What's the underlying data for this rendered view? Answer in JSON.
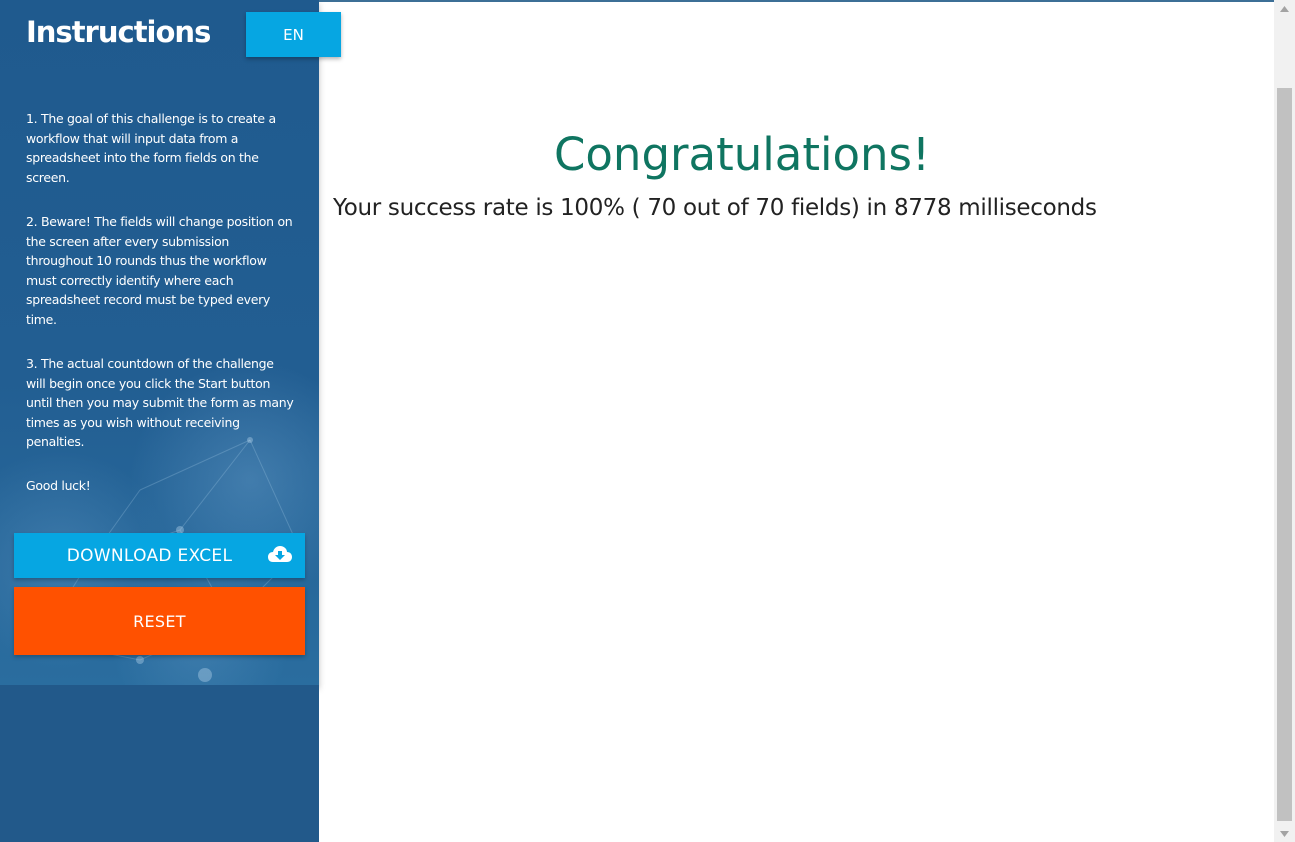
{
  "sidebar": {
    "title": "Instructions",
    "language_button": "EN",
    "instructions": [
      "1. The goal of this challenge is to create a workflow that will input data from a spreadsheet into the form fields on the screen.",
      "2. Beware! The fields will change position on the screen after every submission throughout 10 rounds thus the workflow must correctly identify where each spreadsheet record must be typed every time.",
      "3. The actual countdown of the challenge will begin once you click the Start button until then you may submit the form as many times as you wish without receiving penalties.",
      "Good luck!"
    ],
    "download_button": "DOWNLOAD EXCEL",
    "download_icon": "cloud-download-icon",
    "reset_button": "RESET"
  },
  "main": {
    "heading": "Congratulations!",
    "result": "Your success rate is 100% ( 70 out of 70 fields) in 8778 milliseconds"
  },
  "colors": {
    "sidebar_bg": "#22598a",
    "accent_blue": "#06a6e2",
    "reset_orange": "#ff5100",
    "heading_green": "#0f7561"
  }
}
